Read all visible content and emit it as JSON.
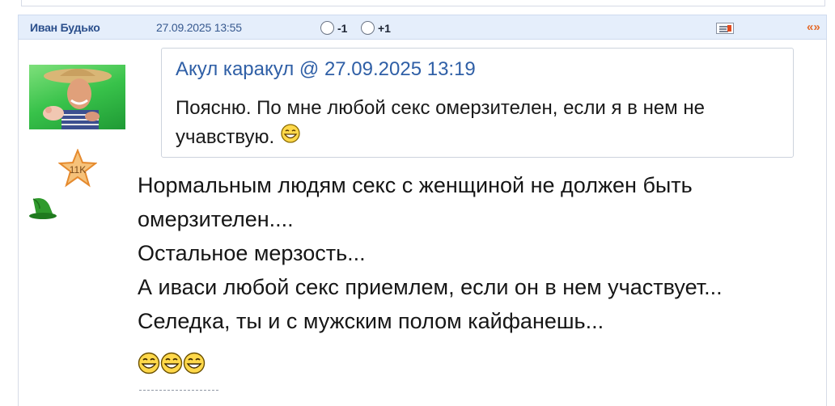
{
  "post": {
    "author": "Иван Будько",
    "date": "27.09.2025 13:55",
    "vote_minus_label": "-1",
    "vote_plus_label": "+1",
    "quote_link_label": "«»",
    "rank_badge": "11K"
  },
  "quote": {
    "header": "Акул каракул @ 27.09.2025 13:19",
    "text": "Поясню. По мне любой секс омерзителен, если я в нем не учавствую."
  },
  "message": {
    "lines": [
      "Нормальным людям секс с женщиной не должен быть",
      "омерзителен....",
      "Остальное мерзость...",
      "А иваси любой секс приемлем, если он в нем участвует...",
      "Селедка, ты и с мужским полом кайфанешь..."
    ]
  },
  "icons": {
    "report": "report-icon",
    "avatar": "avatar-photo",
    "rank": "star-rank-icon",
    "hat": "green-wizard-hat-icon",
    "emoji": "laughing-smiley-icon"
  },
  "colors": {
    "header_bg": "#e5eefb",
    "author": "#2b4f8c",
    "quote_header": "#2f5fa6",
    "quote_link": "#e46a2a"
  }
}
